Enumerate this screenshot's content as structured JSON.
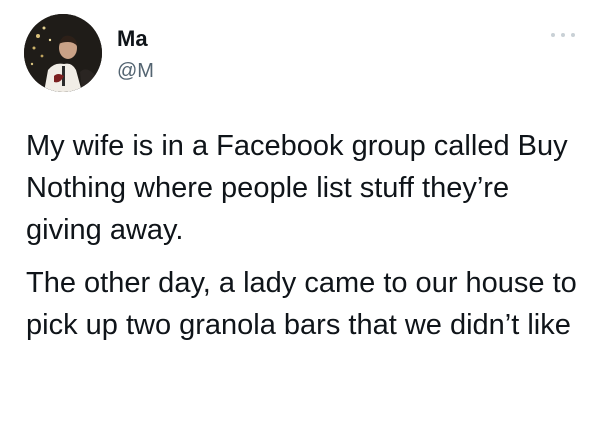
{
  "tweet": {
    "author_name": "Ma",
    "author_handle": "@M",
    "paragraphs": [
      "My wife is in a Facebook group called Buy Nothing where people list stuff they’re giving away.",
      "The other day, a lady came to our house to pick up two granola bars that we didn’t like"
    ],
    "icons": {
      "avatar": "profile-photo",
      "more": "more-options-icon"
    }
  }
}
